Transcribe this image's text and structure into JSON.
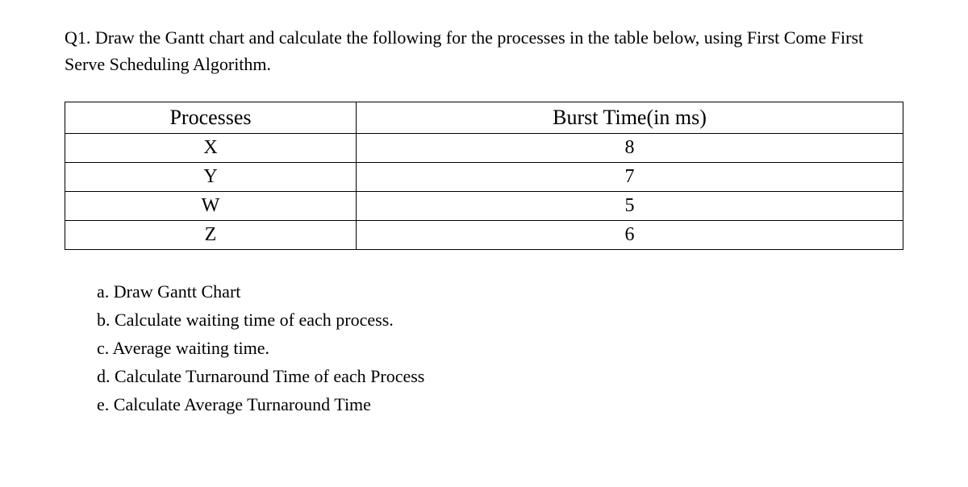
{
  "question": {
    "prompt": "Q1. Draw the Gantt chart and calculate the following for the processes in the table below, using First Come First Serve Scheduling Algorithm."
  },
  "table": {
    "headers": {
      "col1": "Processes",
      "col2": "Burst Time(in ms)"
    },
    "rows": [
      {
        "process": "X",
        "burst": "8"
      },
      {
        "process": "Y",
        "burst": "7"
      },
      {
        "process": "W",
        "burst": "5"
      },
      {
        "process": "Z",
        "burst": "6"
      }
    ]
  },
  "subquestions": {
    "a": "a. Draw Gantt Chart",
    "b": "b. Calculate waiting time of each process.",
    "c": "c. Average waiting time.",
    "d": "d. Calculate Turnaround Time of each Process",
    "e": "e. Calculate Average Turnaround Time"
  }
}
